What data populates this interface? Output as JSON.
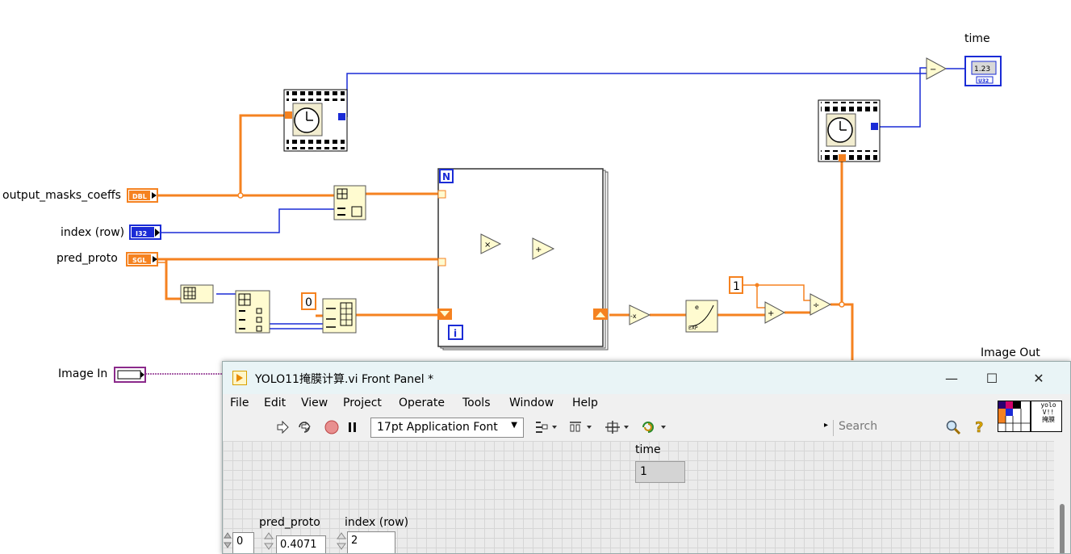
{
  "diagram": {
    "labels": {
      "time": "time",
      "output_masks_coeffs": "output_masks_coeffs",
      "index_row": "index (row)",
      "pred_proto": "pred_proto",
      "image_in": "Image In",
      "image_out": "Image Out"
    },
    "terminals": {
      "dbl": "DBL",
      "i32": "I32",
      "sgl": "SGL",
      "time_indicator": "1.23",
      "time_type": "U32"
    },
    "constants": {
      "zero": "0",
      "one": "1",
      "loop_count": "N",
      "loop_index": "i"
    },
    "colors": {
      "orange_wire": "#f58220",
      "blue_wire": "#1a2bd6",
      "purple_wire": "#8b2a8b"
    }
  },
  "window": {
    "title": "YOLO11掩膜计算.vi Front Panel *",
    "controls": {
      "minimize": "—",
      "maximize": "☐",
      "close": "✕"
    },
    "menu": [
      "File",
      "Edit",
      "View",
      "Project",
      "Operate",
      "Tools",
      "Window",
      "Help"
    ],
    "toolbar": {
      "font": "17pt Application Font",
      "search_placeholder": "Search",
      "icons": [
        "run-arrow-icon",
        "run-continuously-icon",
        "abort-icon",
        "pause-icon",
        "align-icon",
        "distribute-icon",
        "resize-icon",
        "reorder-icon",
        "search-icon",
        "help-icon"
      ]
    },
    "vi_icon_text": [
      "yolo",
      "V!!",
      "掩膜"
    ],
    "panel": {
      "time_label": "time",
      "time_value": "1",
      "array_index": "0",
      "pred_proto_label": "pred_proto",
      "pred_proto_value": "0.4071",
      "index_label": "index (row)",
      "index_value": "2"
    }
  }
}
